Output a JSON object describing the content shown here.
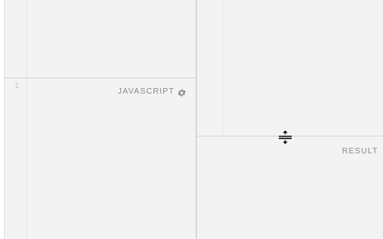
{
  "editor": {
    "line_numbers": [
      "1"
    ],
    "js_panel": {
      "label": "JAVASCRIPT",
      "settings_icon": "gear-icon"
    }
  },
  "result": {
    "label": "RESULT"
  },
  "cursor": {
    "icon": "row-resize-cursor-icon"
  },
  "colors": {
    "background": "#f2f2f2",
    "divider": "#d6d6d6",
    "label": "#8a8a8a",
    "line_number": "#c2c2c2"
  }
}
